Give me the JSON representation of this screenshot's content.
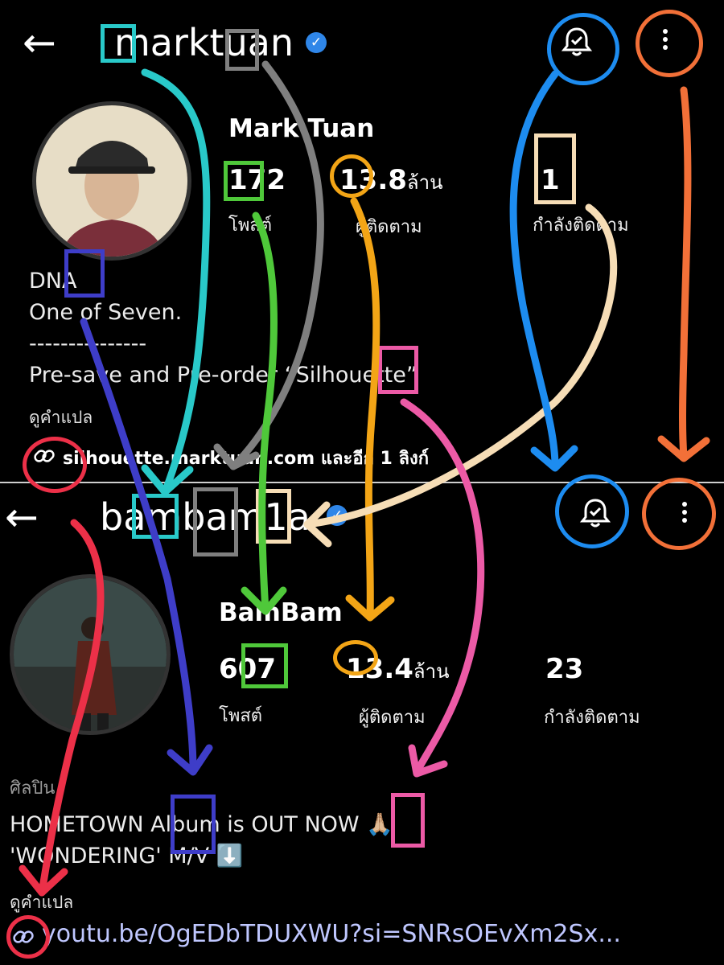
{
  "top": {
    "handle": "marktuan",
    "name": "Mark Tuan",
    "posts": "172",
    "posts_label": "โพสต์",
    "followers": "13.8",
    "followers_unit": "ล้าน",
    "followers_label": "ผู้ติดตาม",
    "following": "1",
    "following_label": "กำลังติดตาม",
    "bio": [
      "DNA",
      "One of Seven.",
      "---------------",
      "Pre-save and Pre-order “Silhouette”"
    ],
    "translate": "ดูคำแปล",
    "link": "silhouette.marktuan.com และอีก 1 ลิงก์"
  },
  "bottom": {
    "handle": "bambam1a",
    "name": "BamBam",
    "posts": "607",
    "posts_label": "โพสต์",
    "followers": "13.4",
    "followers_unit": "ล้าน",
    "followers_label": "ผู้ติดตาม",
    "following": "23",
    "following_label": "กำลังติดตาม",
    "category": "ศิลปิน",
    "bio": [
      "HOMETOWN Album is OUT NOW 🙏🏼",
      "'WONDERING' M/V ⬇️"
    ],
    "translate": "ดูคำแปล",
    "link": "youtu.be/OgEDbTDUXWU?si=SNRsOEvXm2Sx..."
  },
  "icons": {
    "back": "←",
    "verified": "✓"
  },
  "colors": {
    "cyan": "#29c9c9",
    "gray": "#7f7f7f",
    "green": "#4fc83a",
    "orange_gold": "#f3a516",
    "cream": "#f6ddb6",
    "blue": "#1d8cf0",
    "orange": "#f27038",
    "indigo": "#3e3dc8",
    "pink": "#ec5aa6",
    "red": "#ec3048"
  }
}
